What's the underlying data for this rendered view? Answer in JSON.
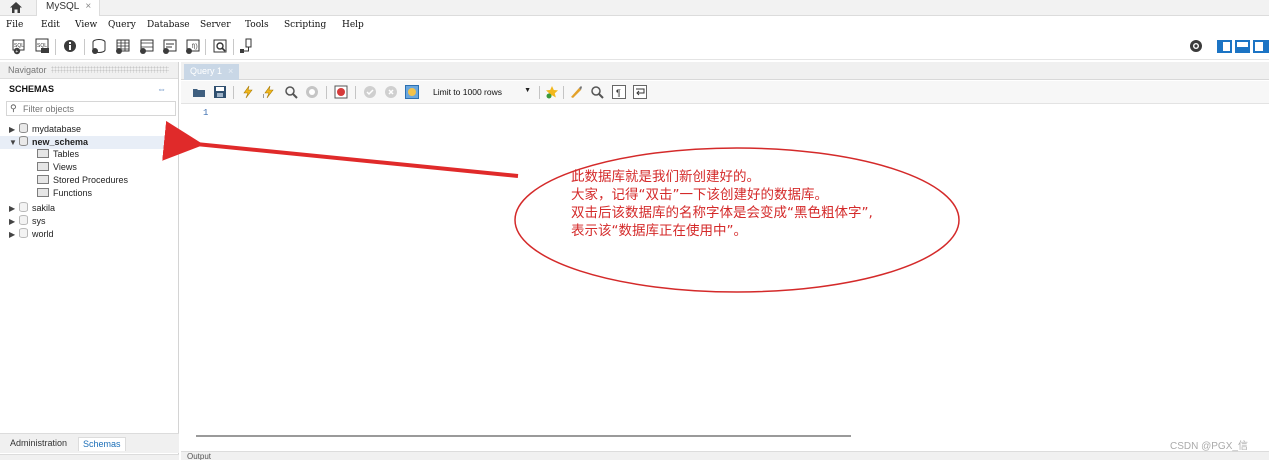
{
  "tabbar": {
    "connection_tab": "MySQL",
    "close_glyph": "×"
  },
  "menu": [
    "File",
    "Edit",
    "View",
    "Query",
    "Database",
    "Server",
    "Tools",
    "Scripting",
    "Help"
  ],
  "main_toolbar": {
    "icons": [
      "new-sql-tab-icon",
      "open-sql-script-icon",
      "inspect-schema-icon",
      "create-schema-icon",
      "create-table-icon",
      "create-view-icon",
      "create-procedure-icon",
      "create-function-icon",
      "search-table-data-icon",
      "reconnect-icon"
    ],
    "right_icons": [
      "settings-icon",
      "toggle-sidebar-icon",
      "toggle-output-icon",
      "toggle-secondary-sidebar-icon"
    ]
  },
  "navigator": {
    "header": "Navigator",
    "schemas_title": "SCHEMAS",
    "filter_placeholder": "Filter objects",
    "tree": [
      {
        "label": "mydatabase",
        "expanded": false,
        "bold": false
      },
      {
        "label": "new_schema",
        "expanded": true,
        "bold": true,
        "children": [
          "Tables",
          "Views",
          "Stored Procedures",
          "Functions"
        ]
      },
      {
        "label": "sakila",
        "expanded": false,
        "bold": false
      },
      {
        "label": "sys",
        "expanded": false,
        "bold": false
      },
      {
        "label": "world",
        "expanded": false,
        "bold": false
      }
    ],
    "bottom_tabs": [
      "Administration",
      "Schemas"
    ],
    "active_bottom_tab": "Schemas"
  },
  "query": {
    "tab_label": "Query 1",
    "close_glyph": "×",
    "toolbar_icons": [
      "open-file-icon",
      "save-icon",
      "execute-icon",
      "execute-current-icon",
      "explain-icon",
      "stop-icon",
      "toggle-error-icon",
      "commit-icon",
      "rollback-icon",
      "autocommit-icon",
      "add-snippet-icon",
      "beautify-icon",
      "find-icon",
      "invisible-chars-icon",
      "wrap-lines-icon"
    ],
    "limit_label": "Limit to 1000 rows",
    "line_numbers": [
      "1"
    ],
    "output_label": "Output"
  },
  "annotation": {
    "lines": [
      "此数据库就是我们新创建好的。",
      "大家，记得“双击”一下该创建好的数据库。",
      "双击后该数据库的名称字体是会变成“黑色粗体字”,",
      "表示该“数据库正在使用中”。"
    ],
    "color": "#d42a2a"
  },
  "watermark": "CSDN @PGX_信"
}
